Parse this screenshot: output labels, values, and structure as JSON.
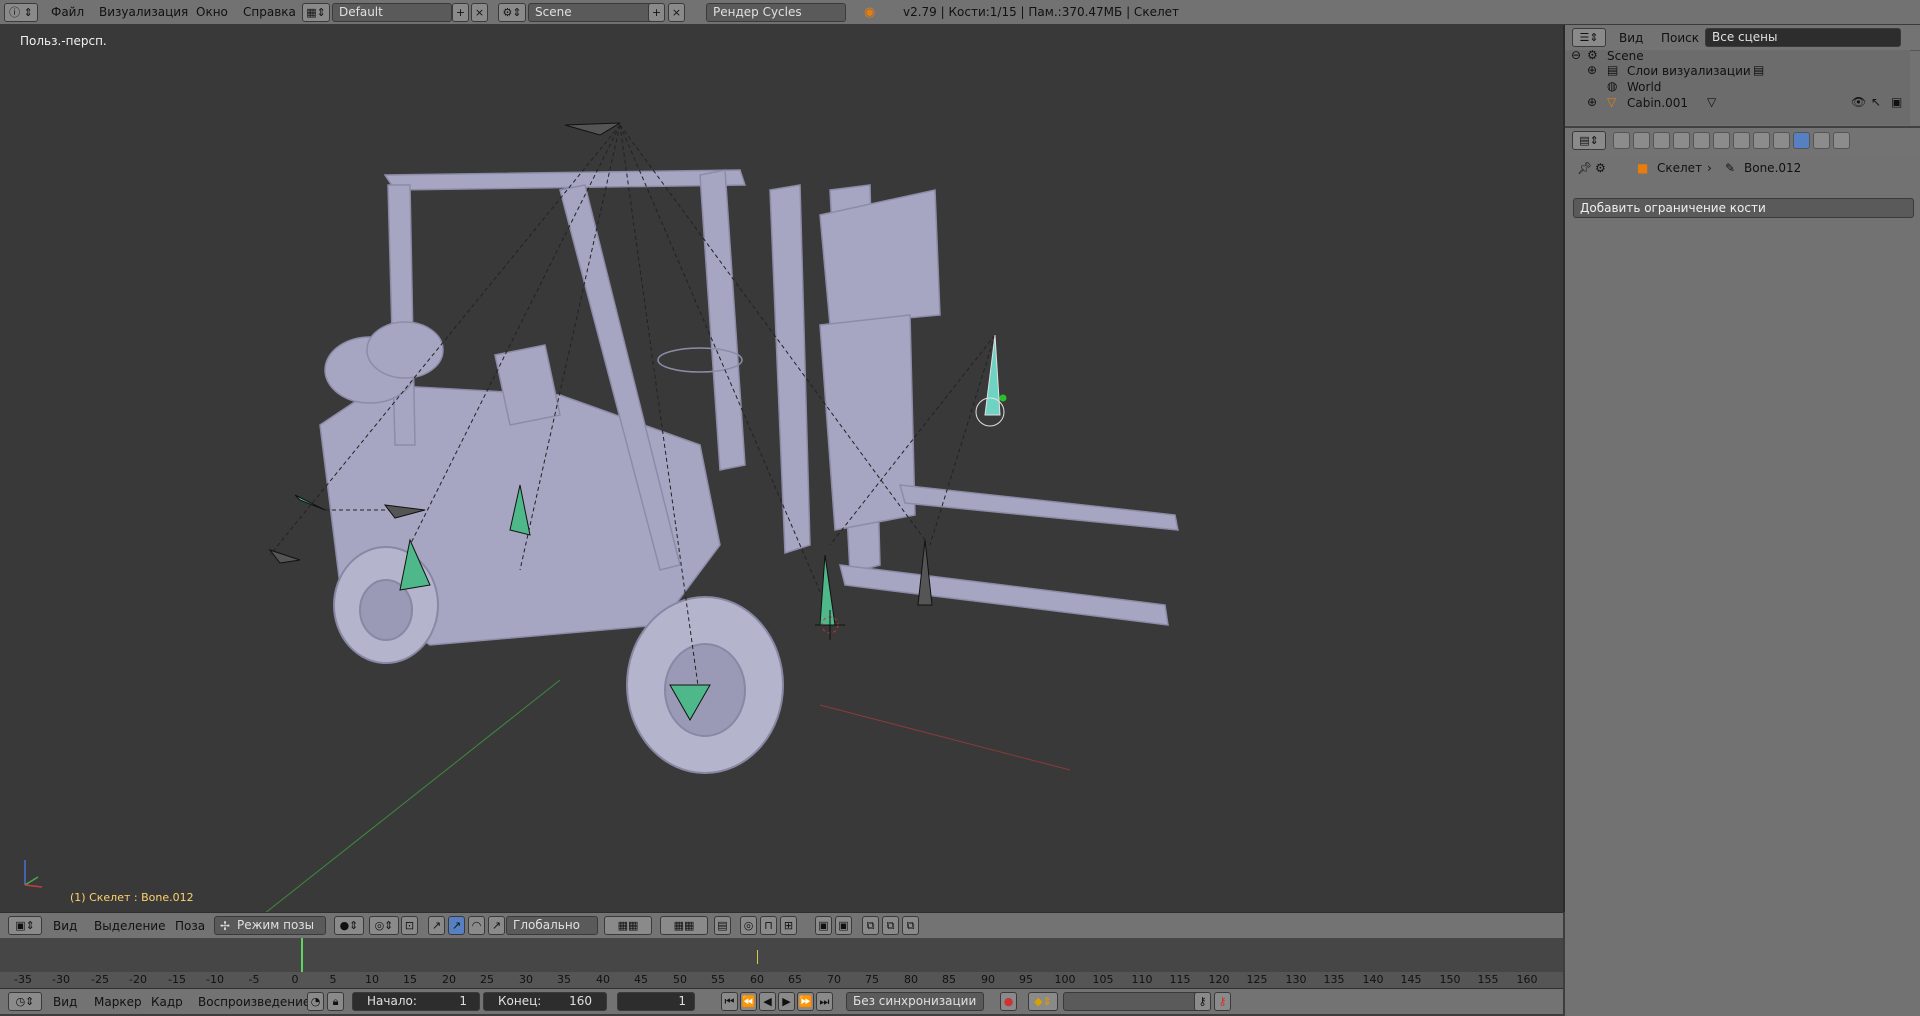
{
  "top": {
    "menu": [
      "Файл",
      "Визуализация",
      "Окно",
      "Справка"
    ],
    "layout": "Default",
    "scene": "Scene",
    "engine": "Рендер Cycles",
    "info": "v2.79 | Кости:1/15 | Пам.:370.47МБ | Скелет"
  },
  "viewport": {
    "label": "Польз.-персп.",
    "selection": "(1) Скелет : Bone.012"
  },
  "viewport_header": {
    "menu": [
      "Вид",
      "Выделение",
      "Поза"
    ],
    "mode": "Режим позы",
    "orientation": "Глобально"
  },
  "timeline": {
    "ticks": [
      "-35",
      "-30",
      "-25",
      "-20",
      "-15",
      "-10",
      "-5",
      "0",
      "5",
      "10",
      "15",
      "20",
      "25",
      "30",
      "35",
      "40",
      "45",
      "50",
      "55",
      "60",
      "65",
      "70",
      "75",
      "80",
      "85",
      "90",
      "95",
      "100",
      "105",
      "110",
      "115",
      "120",
      "125",
      "130",
      "135",
      "140",
      "145",
      "150",
      "155",
      "160"
    ],
    "current_frame_marker": "1",
    "keyframe": "60"
  },
  "bottom": {
    "menu": [
      "Вид",
      "Маркер",
      "Кадр",
      "Воспроизведение"
    ],
    "start_label": "Начало:",
    "start_value": "1",
    "end_label": "Конец:",
    "end_value": "160",
    "current": "1",
    "sync": "Без синхронизации"
  },
  "outliner": {
    "view": "Вид",
    "search": "Поиск",
    "filter": "Все сцены",
    "rows": [
      "Scene",
      "Слои визуализации",
      "World",
      "Cabin.001"
    ]
  },
  "properties": {
    "crumbs": [
      "Скелет",
      "Bone.012"
    ],
    "add_constraint": "Добавить ограничение кости"
  },
  "colors": {
    "bone_selected": "#6fd3c4",
    "bone_green": "#4fb88a",
    "accent": "#5680c2"
  }
}
